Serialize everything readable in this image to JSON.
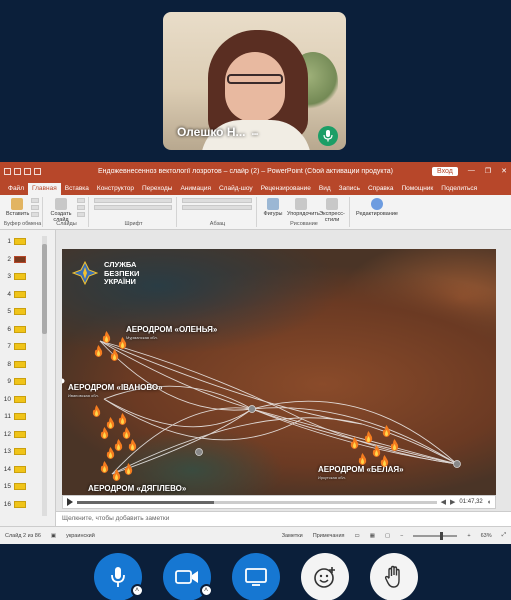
{
  "participant": {
    "name": "Олешко Н...",
    "more_glyph": "•••",
    "mic_icon": "microphone-icon"
  },
  "powerpoint": {
    "window_title": "Ендожевнесенноз вектології лозротов – слайр (2) – PowerPoint (Сбой активации продукта)",
    "signin_label": "Вход",
    "window_buttons": [
      "—",
      "❐",
      "✕"
    ],
    "menu_tabs": [
      "Файл",
      "Главная",
      "Вставка",
      "Конструктор",
      "Переходы",
      "Анимация",
      "Слайд-шоу",
      "Рецензирование",
      "Вид",
      "Запись",
      "Справка",
      "Помощник",
      "Поделиться"
    ],
    "active_tab_index": 1,
    "ribbon": {
      "groups": [
        {
          "label": "Буфер обмена",
          "buttons": [
            "Вставить"
          ]
        },
        {
          "label": "Слайды",
          "buttons": [
            "Создать слайд"
          ]
        },
        {
          "label": "Шрифт",
          "buttons": []
        },
        {
          "label": "Абзац",
          "buttons": []
        },
        {
          "label": "Рисование",
          "buttons": [
            "Фигуры",
            "Упорядочить",
            "Экспресс-стили"
          ]
        },
        {
          "label": "",
          "buttons": [
            "Редактирование"
          ]
        }
      ]
    },
    "slide_numbers": [
      "1",
      "2",
      "3",
      "4",
      "5",
      "6",
      "7",
      "8",
      "9",
      "10",
      "11",
      "12",
      "13",
      "14",
      "15",
      "16"
    ],
    "current_slide_index": 1,
    "slide": {
      "org_title": [
        "СЛУЖБА",
        "БЕЗПЕКИ",
        "УКРАЇНИ"
      ],
      "labels": [
        {
          "text": "АЕРОДРОМ «ОЛЕНЬЯ»",
          "sub": "Мурманская обл."
        },
        {
          "text": "АЕРОДРОМ «ІВАНОВО»",
          "sub": "Ивановская обл."
        },
        {
          "text": "АЕРОДРОМ «ДЯГІЛЕВО»",
          "sub": ""
        },
        {
          "text": "АЕРОДРОМ «БЕЛАЯ»",
          "sub": "Иркутская обл."
        }
      ]
    },
    "media": {
      "elapsed": "01:47,32",
      "progress": 0.38
    },
    "notes_placeholder": "Щелкните, чтобы добавить заметки",
    "status": {
      "slide_info": "Слайд 2 из 86",
      "language": "украинский",
      "notes_label": "Заметки",
      "comments_label": "Примечания",
      "zoom": "63%",
      "zoom_fraction": 0.63
    }
  },
  "call_controls": [
    {
      "name": "microphone-button",
      "icon": "microphone-icon",
      "style": "blue",
      "has_menu": true
    },
    {
      "name": "camera-button",
      "icon": "video-camera-icon",
      "style": "blue",
      "has_menu": true
    },
    {
      "name": "share-screen-button",
      "icon": "screen-share-icon",
      "style": "blue",
      "has_menu": false
    },
    {
      "name": "reactions-button",
      "icon": "emoji-icon",
      "style": "white",
      "has_menu": false
    },
    {
      "name": "raise-hand-button",
      "icon": "hand-icon",
      "style": "white",
      "has_menu": false
    }
  ],
  "colors": {
    "background": "#0b1f3a",
    "powerpoint_accent": "#b7472a",
    "call_blue": "#1677d2",
    "mic_green": "#1b9e66"
  }
}
